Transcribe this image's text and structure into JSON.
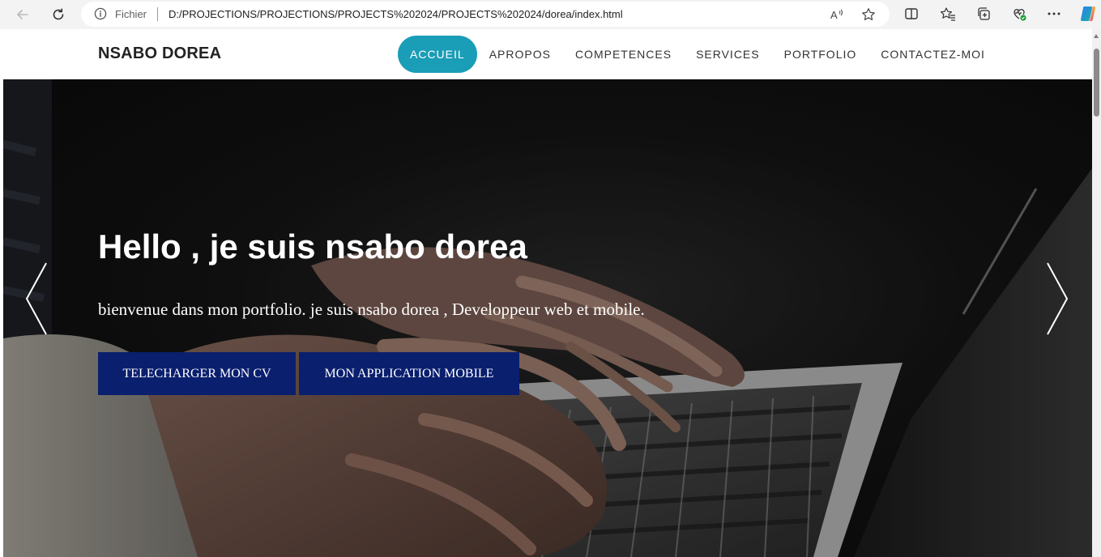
{
  "browser": {
    "scheme_label": "Fichier",
    "url": "D:/PROJECTIONS/PROJECTIONS/PROJECTS%202024/PROJECTS%202024/dorea/index.html",
    "icons": [
      "back-arrow-icon",
      "refresh-icon",
      "info-icon",
      "read-aloud-icon",
      "favorite-star-icon",
      "split-screen-icon",
      "favorites-icon",
      "collections-icon",
      "browser-essentials-icon",
      "more-menu-icon",
      "copilot-icon"
    ]
  },
  "site": {
    "brand": "NSABO DOREA",
    "menu": [
      {
        "label": "ACCUEIL",
        "active": true
      },
      {
        "label": "APROPOS",
        "active": false
      },
      {
        "label": "COMPETENCES",
        "active": false
      },
      {
        "label": "SERVICES",
        "active": false
      },
      {
        "label": "PORTFOLIO",
        "active": false
      },
      {
        "label": "CONTACTEZ-MOI",
        "active": false
      }
    ]
  },
  "hero": {
    "title": "Hello , je suis nsabo dorea",
    "subtitle": "bienvenue dans mon portfolio. je suis nsabo dorea , Developpeur web et mobile.",
    "buttons": {
      "cv": "TELECHARGER MON CV",
      "app": "MON APPLICATION MOBILE"
    }
  },
  "colors": {
    "active_menu": "#1a9db7",
    "hero_button": "#0a1f6e"
  }
}
